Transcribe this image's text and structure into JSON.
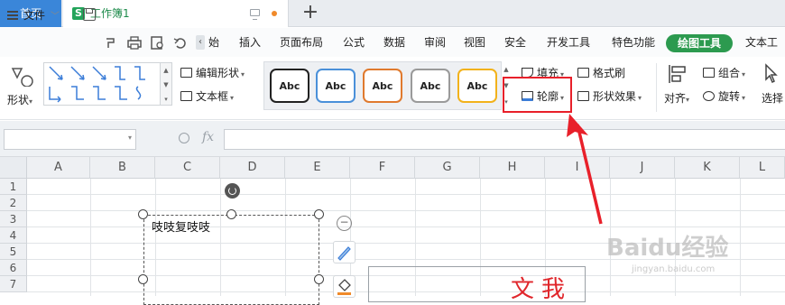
{
  "tabs": {
    "home": "首页",
    "workbook_icon": "S",
    "workbook": "工作簿1",
    "new_tab": "+"
  },
  "menu": {
    "file": "文件",
    "items": [
      "始",
      "插入",
      "页面布局",
      "公式",
      "数据",
      "审阅",
      "视图",
      "安全",
      "开发工具",
      "特色功能"
    ],
    "active": "绘图工具",
    "next": "文本工具"
  },
  "ribbon": {
    "shape": "形状",
    "edit_shape": "编辑形状",
    "text_box": "文本框",
    "style_swatches": [
      {
        "label": "Abc",
        "border": "#222222"
      },
      {
        "label": "Abc",
        "border": "#4a90d9"
      },
      {
        "label": "Abc",
        "border": "#e07a2e"
      },
      {
        "label": "Abc",
        "border": "#9a9a9a"
      },
      {
        "label": "Abc",
        "border": "#f2b21b"
      }
    ],
    "fill": "填充",
    "format_painter": "格式刷",
    "outline": "轮廓",
    "shape_effects": "形状效果",
    "align": "对齐",
    "group": "组合",
    "rotate": "旋转",
    "select": "选择"
  },
  "formula_bar": {
    "fx": "fx"
  },
  "grid": {
    "columns": [
      "A",
      "B",
      "C",
      "D",
      "E",
      "F",
      "G",
      "H",
      "I",
      "J",
      "K",
      "L"
    ],
    "rows": [
      "1",
      "2",
      "3",
      "4",
      "5",
      "6",
      "7"
    ]
  },
  "textbox": {
    "text": "吱吱复吱吱"
  },
  "float_toolbar": {
    "minus": "−"
  },
  "textbox2": {
    "text": "文我"
  },
  "watermark": {
    "text": "Baidu经验",
    "sub": "jingyan.baidu.com"
  },
  "colors": {
    "accent_green": "#2c9a4f",
    "tab_blue": "#3a86d9",
    "annotation_red": "#e8202a"
  }
}
